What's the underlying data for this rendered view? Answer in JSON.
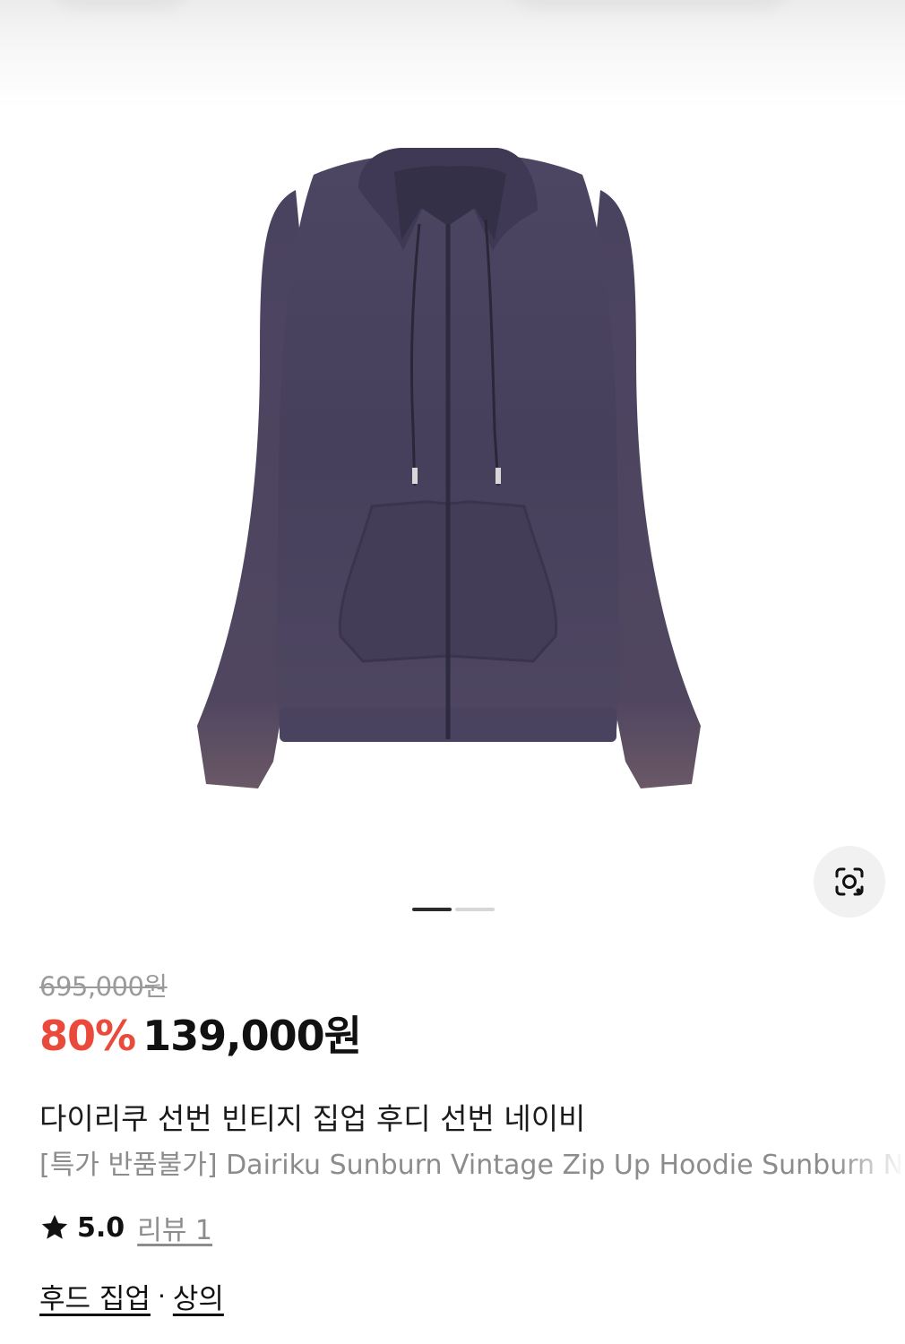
{
  "product": {
    "image_alt": "네이비 빈티지 집업 후디",
    "original_price": "695,000원",
    "discount": "80%",
    "sale_price": "139,000원",
    "title_ko": "다이리쿠 선번 빈티지 집업 후디 선번 네이비",
    "title_en": "[특가 반품불가] Dairiku Sunburn Vintage Zip Up Hoodie Sunburn Navy",
    "rating": "5.0",
    "review_label": "리뷰 1",
    "pager": {
      "total": 2,
      "active": 0
    }
  },
  "categories": [
    "후드 집업",
    "상의"
  ],
  "separator": "·",
  "icons": {
    "lens": "lens-search-icon",
    "star": "star-icon"
  },
  "colors": {
    "discount": "#ea4a3b",
    "hoodie": "#4a4460",
    "text": "#111111",
    "muted": "#8c8c8c"
  }
}
